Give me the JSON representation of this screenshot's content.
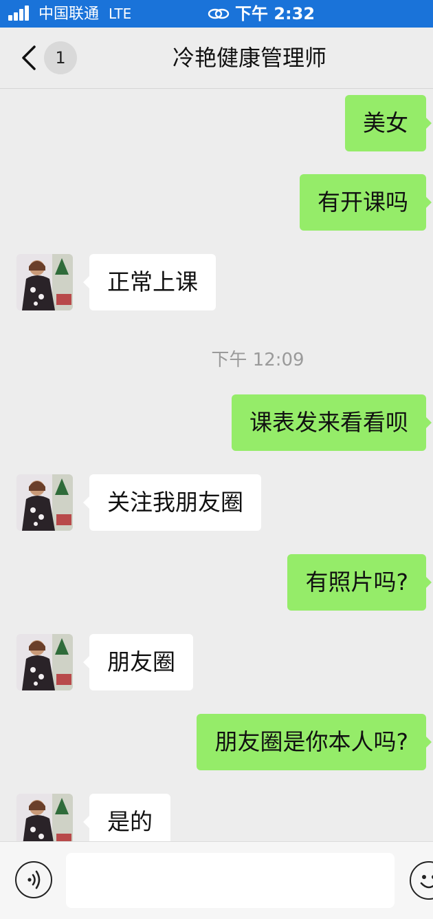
{
  "status_bar": {
    "carrier": "中国联通",
    "network": "LTE",
    "time": "下午 2:32"
  },
  "header": {
    "back_icon": "chevron-left-icon",
    "unread_count": "1",
    "title": "冷艳健康管理师"
  },
  "messages": [
    {
      "type": "outgoing",
      "text": "美女"
    },
    {
      "type": "outgoing",
      "text": "有开课吗"
    },
    {
      "type": "incoming",
      "text": "正常上课"
    },
    {
      "type": "timestamp",
      "text": "下午 12:09"
    },
    {
      "type": "outgoing",
      "text": "课表发来看看呗"
    },
    {
      "type": "incoming",
      "text": "关注我朋友圈"
    },
    {
      "type": "outgoing",
      "text": "有照片吗?"
    },
    {
      "type": "incoming",
      "text": "朋友圈"
    },
    {
      "type": "outgoing",
      "text": "朋友圈是你本人吗?"
    },
    {
      "type": "incoming",
      "text": "是的"
    }
  ],
  "input_bar": {
    "voice_icon": "voice-icon",
    "message_value": "",
    "emoji_icon": "emoji-icon"
  },
  "colors": {
    "status_bar": "#1a73d9",
    "outgoing_bubble": "#95ec69",
    "incoming_bubble": "#ffffff",
    "background": "#ededed"
  }
}
